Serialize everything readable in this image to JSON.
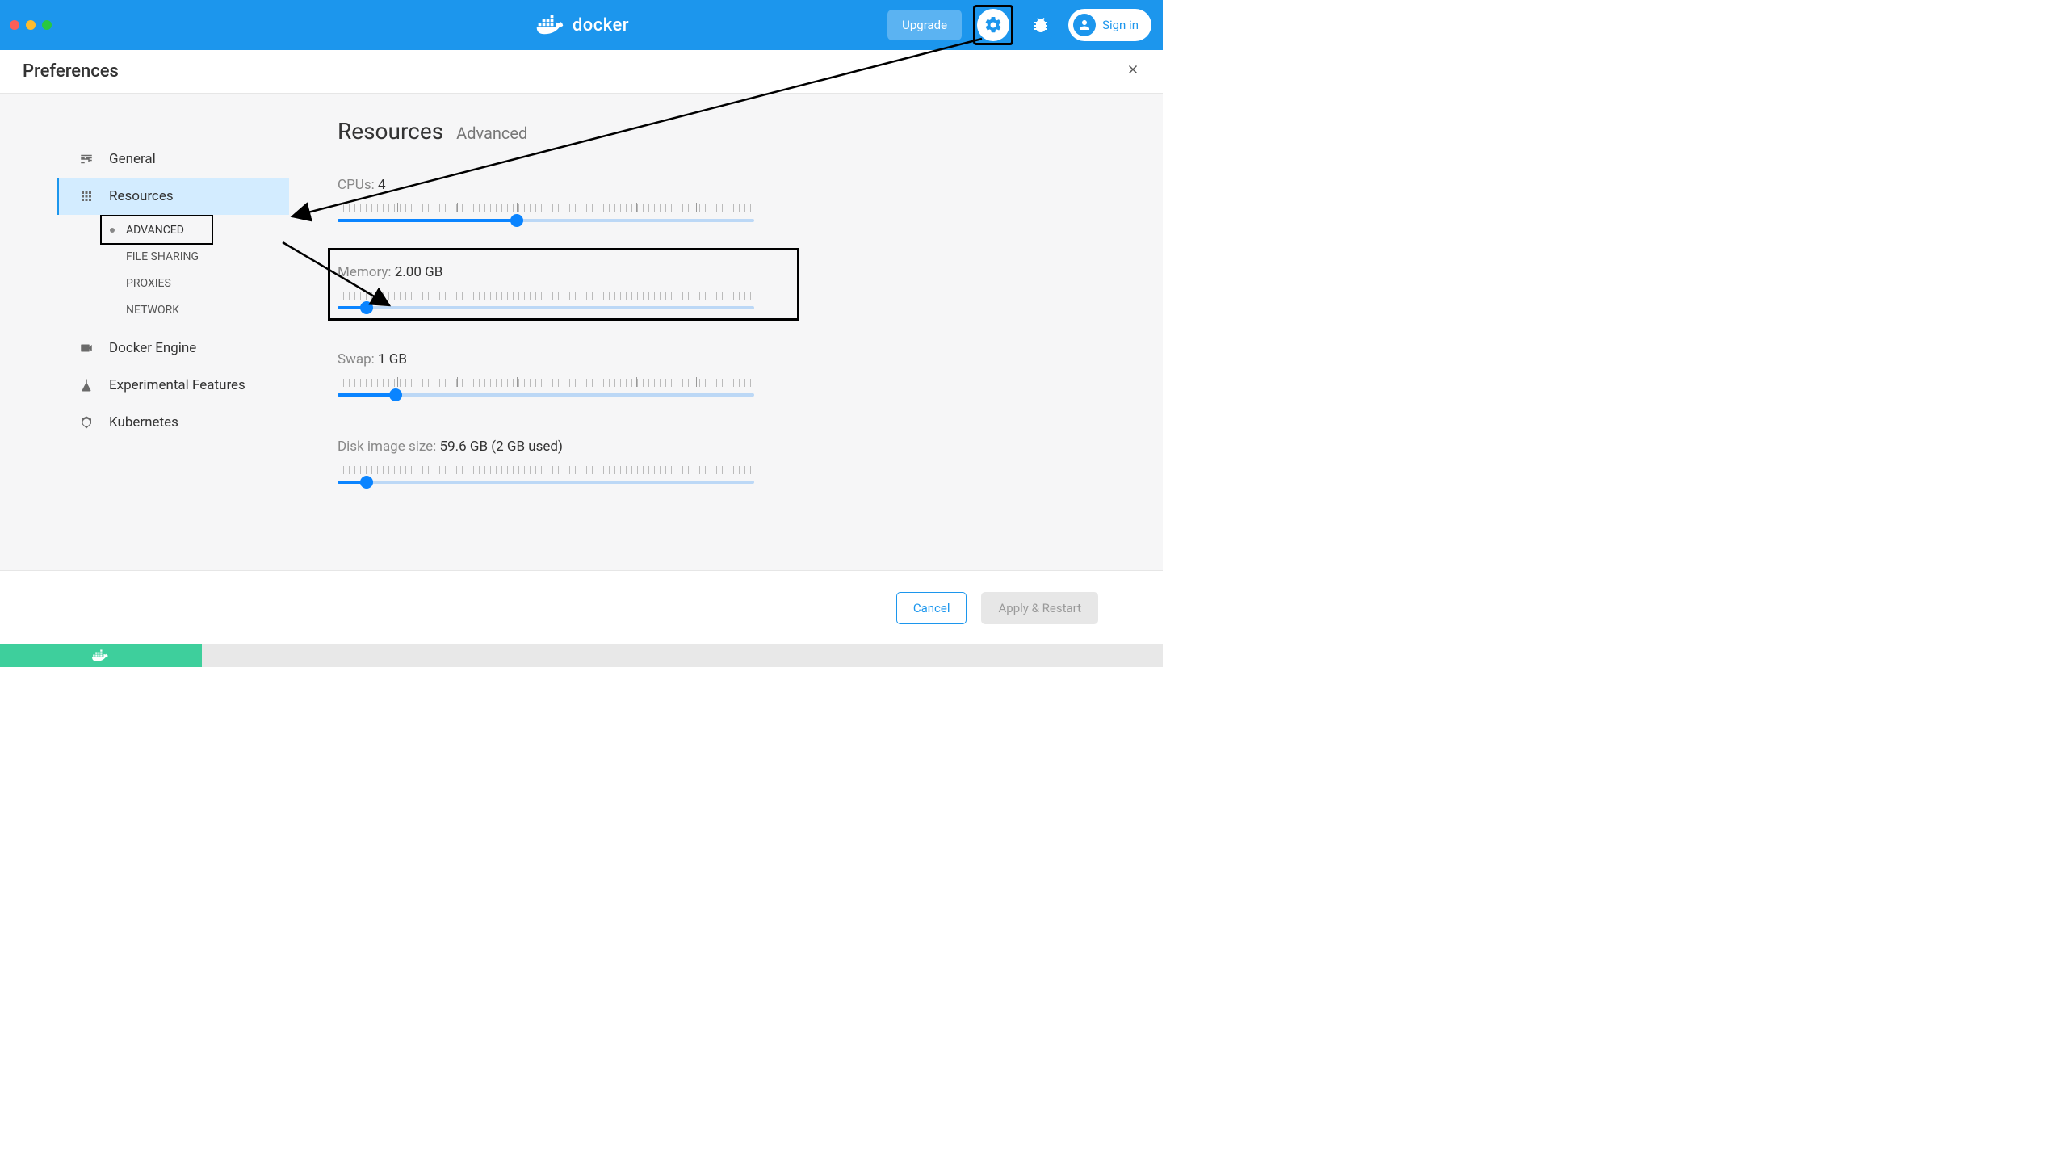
{
  "header": {
    "brand": "docker",
    "upgrade_label": "Upgrade",
    "signin_label": "Sign in"
  },
  "prefs": {
    "title": "Preferences"
  },
  "sidebar": {
    "items": [
      {
        "label": "General"
      },
      {
        "label": "Resources"
      },
      {
        "label": "Docker Engine"
      },
      {
        "label": "Experimental Features"
      },
      {
        "label": "Kubernetes"
      }
    ],
    "sub": [
      {
        "label": "ADVANCED"
      },
      {
        "label": "FILE SHARING"
      },
      {
        "label": "PROXIES"
      },
      {
        "label": "NETWORK"
      }
    ]
  },
  "content": {
    "heading_main": "Resources",
    "heading_sub": "Advanced",
    "settings": {
      "cpus": {
        "name": "CPUs:",
        "value": "4",
        "fill_pct": 43
      },
      "memory": {
        "name": "Memory:",
        "value": "2.00 GB",
        "fill_pct": 7
      },
      "swap": {
        "name": "Swap:",
        "value": "1 GB",
        "fill_pct": 14
      },
      "disk": {
        "name": "Disk image size:",
        "value": "59.6 GB (2 GB used)",
        "fill_pct": 7
      }
    }
  },
  "footer": {
    "cancel": "Cancel",
    "apply": "Apply & Restart"
  }
}
